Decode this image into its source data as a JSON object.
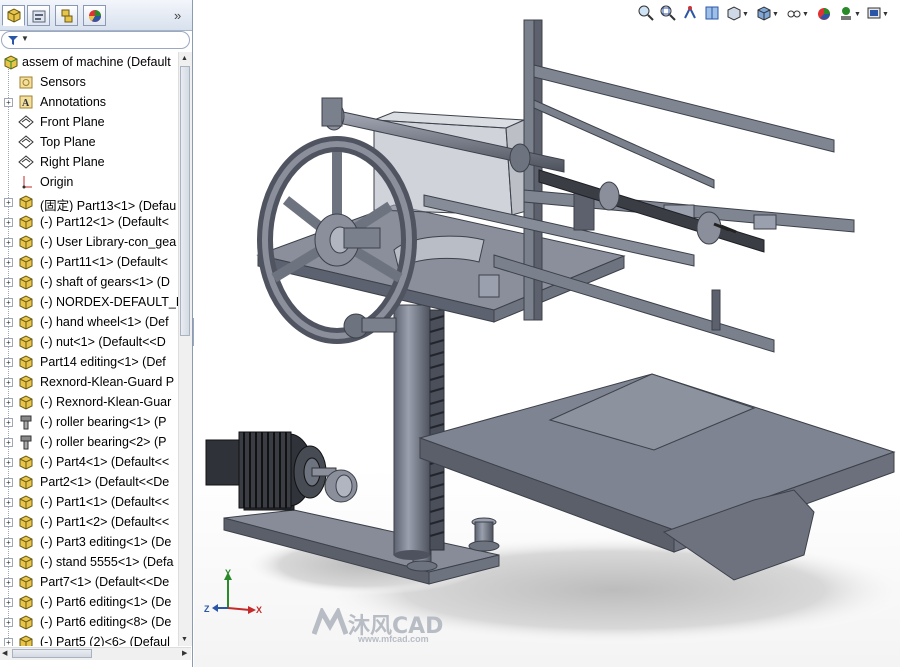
{
  "feature_tree": {
    "root": "assem of machine  (Default",
    "items": [
      {
        "label": "Sensors",
        "icon": "sensors-icon",
        "expand": false
      },
      {
        "label": "Annotations",
        "icon": "annotations-icon",
        "expand": true
      },
      {
        "label": "Front Plane",
        "icon": "plane-icon",
        "expand": false
      },
      {
        "label": "Top Plane",
        "icon": "plane-icon",
        "expand": false
      },
      {
        "label": "Right Plane",
        "icon": "plane-icon",
        "expand": false
      },
      {
        "label": "Origin",
        "icon": "origin-icon",
        "expand": false
      },
      {
        "label": "(固定) Part13<1> (Defau",
        "icon": "part-icon",
        "expand": true
      },
      {
        "label": "(-) Part12<1> (Default<",
        "icon": "part-icon",
        "expand": true
      },
      {
        "label": "(-) User Library-con_gea",
        "icon": "part-icon",
        "expand": true
      },
      {
        "label": "(-) Part11<1> (Default<",
        "icon": "part-icon",
        "expand": true
      },
      {
        "label": "(-) shaft of gears<1> (D",
        "icon": "part-icon",
        "expand": true
      },
      {
        "label": "(-) NORDEX-DEFAULT_L",
        "icon": "part-icon",
        "expand": true
      },
      {
        "label": "(-) hand wheel<1> (Def",
        "icon": "part-icon",
        "expand": true
      },
      {
        "label": "(-) nut<1> (Default<<D",
        "icon": "part-icon",
        "expand": true
      },
      {
        "label": "Part14 editing<1> (Def",
        "icon": "part-icon",
        "expand": true
      },
      {
        "label": "Rexnord-Klean-Guard P",
        "icon": "part-icon",
        "expand": true
      },
      {
        "label": "(-) Rexnord-Klean-Guar",
        "icon": "part-icon",
        "expand": true
      },
      {
        "label": "(-) roller bearing<1> (P",
        "icon": "toolbox-part-icon",
        "expand": true
      },
      {
        "label": "(-) roller bearing<2> (P",
        "icon": "toolbox-part-icon",
        "expand": true
      },
      {
        "label": "(-) Part4<1> (Default<<",
        "icon": "part-icon",
        "expand": true
      },
      {
        "label": "Part2<1> (Default<<De",
        "icon": "part-icon",
        "expand": true
      },
      {
        "label": "(-) Part1<1> (Default<<",
        "icon": "part-icon",
        "expand": true
      },
      {
        "label": "(-) Part1<2> (Default<<",
        "icon": "part-icon",
        "expand": true
      },
      {
        "label": "(-) Part3 editing<1> (De",
        "icon": "part-icon",
        "expand": true
      },
      {
        "label": "(-) stand 5555<1> (Defa",
        "icon": "part-icon",
        "expand": true
      },
      {
        "label": "Part7<1> (Default<<De",
        "icon": "part-icon",
        "expand": true
      },
      {
        "label": "(-) Part6 editing<1> (De",
        "icon": "part-icon",
        "expand": true
      },
      {
        "label": "(-) Part6 editing<8> (De",
        "icon": "part-icon",
        "expand": true
      },
      {
        "label": "(-) Part5 (2)<6> (Defaul",
        "icon": "part-icon",
        "expand": true
      }
    ]
  },
  "panel_tabs": [
    "featuremanager-tab",
    "propertymanager-tab",
    "configurationmanager-tab",
    "appearance-tab"
  ],
  "headsup_toolbar": [
    "zoom-to-fit-icon",
    "zoom-to-area-icon",
    "previous-view-icon",
    "section-view-icon",
    "view-orientation-icon",
    "display-style-icon",
    "hide-show-items-icon",
    "edit-appearance-icon",
    "apply-scene-icon",
    "view-settings-icon"
  ],
  "triad": {
    "x": "X",
    "y": "Y",
    "z": "Z"
  },
  "watermark": {
    "text": "沐风CAD",
    "url": "www.mfcad.com"
  },
  "colors": {
    "accent": "#2b56a8",
    "model": "#7e8491",
    "model_dark": "#3c414a",
    "shadow": "#c8c8c8"
  }
}
